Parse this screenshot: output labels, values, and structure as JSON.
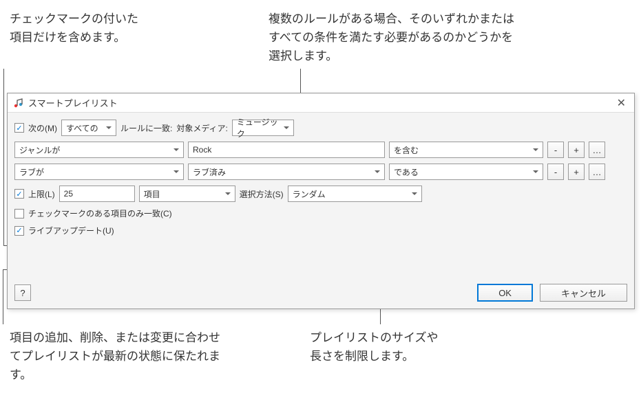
{
  "annotations": {
    "topleft": "チェックマークの付いた項目だけを含めます。",
    "topright": "複数のルールがある場合、そのいずれかまたはすべての条件を満たす必要があるのかどうかを選択します。",
    "botleft": "項目の追加、削除、または変更に合わせてプレイリストが最新の状態に保たれます。",
    "botright": "プレイリストのサイズや長さを制限します。"
  },
  "dialog": {
    "title": "スマートプレイリスト",
    "match": {
      "checkbox_label": "次の(M)",
      "anyall": "すべての",
      "rules_label": "ルールに一致:",
      "media_label": "対象メディア:",
      "media_value": "ミュージック"
    },
    "rules": [
      {
        "field": "ジャンルが",
        "value": "Rock",
        "op": "を含む",
        "is_select_value": false
      },
      {
        "field": "ラブが",
        "value": "ラブ済み",
        "op": "である",
        "is_select_value": true
      }
    ],
    "limit": {
      "label": "上限(L)",
      "value": "25",
      "unit": "項目",
      "selby_label": "選択方法(S)",
      "selby_value": "ランダム"
    },
    "checked_only_label": "チェックマークのある項目のみ一致(C)",
    "live_update_label": "ライブアップデート(U)",
    "buttons": {
      "help": "?",
      "ok": "OK",
      "cancel": "キャンセル",
      "minus": "-",
      "plus": "+",
      "more": "…"
    }
  }
}
